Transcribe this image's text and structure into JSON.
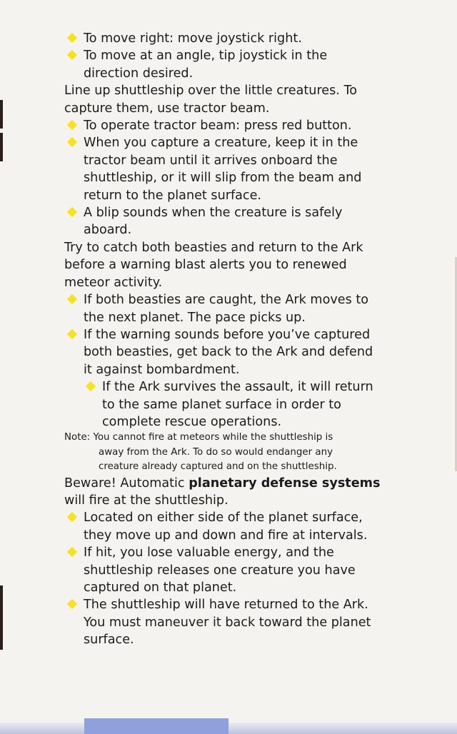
{
  "colors": {
    "bullet": "#f7e21e",
    "text": "#1b1b1b",
    "page": "#f4f3ef",
    "strip": "#8fa0dc"
  },
  "bullet_icon": "yellow-diamond",
  "lines": [
    {
      "t": "To move right: move joystick right."
    },
    {
      "t": "To move at an angle, tip joystick in the"
    },
    {
      "t": "direction desired."
    },
    {
      "t": "Line up shuttleship over the little creatures. To"
    },
    {
      "t": "capture them, use tractor beam."
    },
    {
      "t": "To operate tractor beam: press red button."
    },
    {
      "t": "When you capture a creature, keep it in the"
    },
    {
      "t": "tractor beam until it arrives onboard the"
    },
    {
      "t": "shuttleship, or it will slip from the beam and"
    },
    {
      "t": "return to the planet surface."
    },
    {
      "t": "A blip sounds when the creature is safely"
    },
    {
      "t": "aboard."
    },
    {
      "t": "Try to catch both beasties and return to the Ark"
    },
    {
      "t": "before a warning blast alerts you to renewed"
    },
    {
      "t": "meteor activity."
    },
    {
      "t": "If both beasties are caught, the Ark moves to"
    },
    {
      "t": "the next planet. The pace picks up."
    },
    {
      "t": "If the warning sounds before you’ve captured"
    },
    {
      "t": "both beasties, get back to the Ark and defend"
    },
    {
      "t": "it against bombardment."
    },
    {
      "t": "If the Ark survives the assault, it will return"
    },
    {
      "t": "to the same planet surface in order to"
    },
    {
      "t": "complete rescue operations."
    }
  ],
  "note": [
    {
      "t": "Note: You cannot fire at meteors while the shuttleship is"
    },
    {
      "t": "away from the Ark. To do so would endanger any"
    },
    {
      "t": "creature already captured and on the shuttleship."
    }
  ],
  "beware": {
    "pre": "Beware! Automatic ",
    "bold": "planetary defense systems",
    "cont": "will fire at the shuttleship."
  },
  "lines2": [
    {
      "t": "Located on either side of the planet surface,"
    },
    {
      "t": "they move up and down and fire at intervals."
    },
    {
      "t": "If hit, you lose valuable energy, and the"
    },
    {
      "t": "shuttleship releases one creature you have"
    },
    {
      "t": "captured on that planet."
    },
    {
      "t": "The shuttleship will have returned to the Ark."
    },
    {
      "t": "You must maneuver it back toward the planet"
    },
    {
      "t": "surface."
    }
  ]
}
